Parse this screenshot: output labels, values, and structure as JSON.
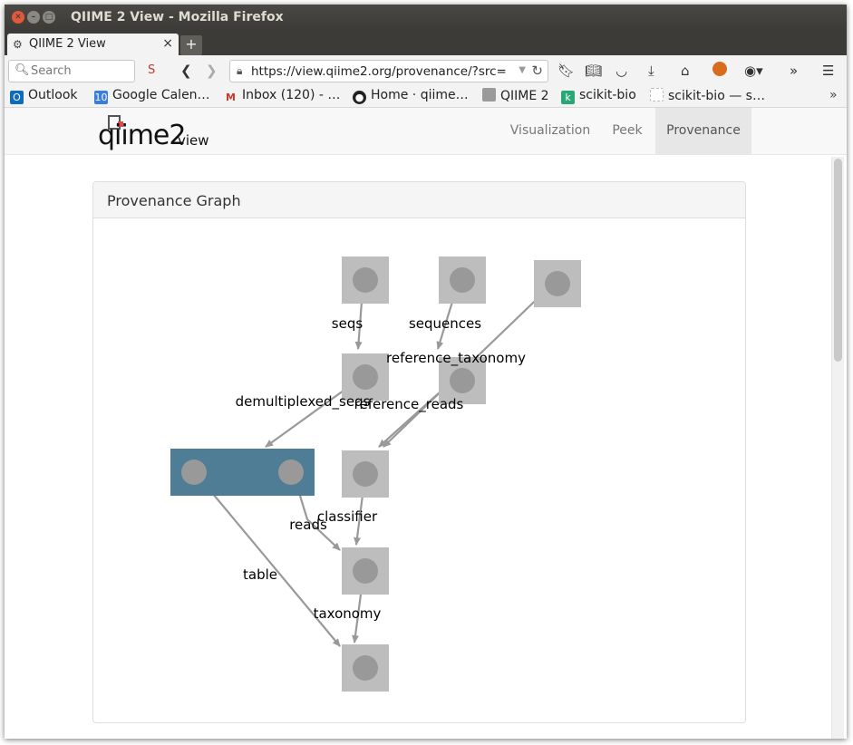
{
  "window": {
    "title": "QIIME 2 View - Mozilla Firefox",
    "tab_label": "QIIME 2 View",
    "tab_close": "×",
    "new_tab": "+"
  },
  "navbar": {
    "search_placeholder": "Search",
    "url": "https://view.qiime2.org/provenance/?src="
  },
  "bookmarks": [
    {
      "label": "Outlook",
      "icon": "outlook-icon",
      "color": "#0f6cbd"
    },
    {
      "label": "Google Calen…",
      "icon": "google-calendar-icon",
      "color": "#3b7de0"
    },
    {
      "label": "Inbox (120) - …",
      "icon": "gmail-icon",
      "color": "#d93025"
    },
    {
      "label": "Home · qiime…",
      "icon": "github-icon",
      "color": "#222222"
    },
    {
      "label": "QIIME 2",
      "icon": "folder-icon",
      "color": "#9a9a9a"
    },
    {
      "label": "scikit-bio",
      "icon": "scikit-bio-icon",
      "color": "#29a875"
    },
    {
      "label": "scikit-bio — s…",
      "icon": "page-icon",
      "color": "#dddddd"
    }
  ],
  "app": {
    "logo_text": "qiime2",
    "logo_sub": "view",
    "tabs": [
      {
        "label": "Visualization",
        "active": false
      },
      {
        "label": "Peek",
        "active": false
      },
      {
        "label": "Provenance",
        "active": true
      }
    ]
  },
  "panel": {
    "title": "Provenance Graph"
  },
  "graph": {
    "colors": {
      "artifact_fill": "#bdbdbd",
      "circle_fill": "#999999",
      "highlight_fill": "#4f7d96",
      "edge": "#999999"
    },
    "edge_labels": [
      "seqs",
      "sequences",
      "reference_taxonomy",
      "demultiplexed_seqs",
      "reference_reads",
      "classifier",
      "reads",
      "table",
      "taxonomy"
    ]
  }
}
